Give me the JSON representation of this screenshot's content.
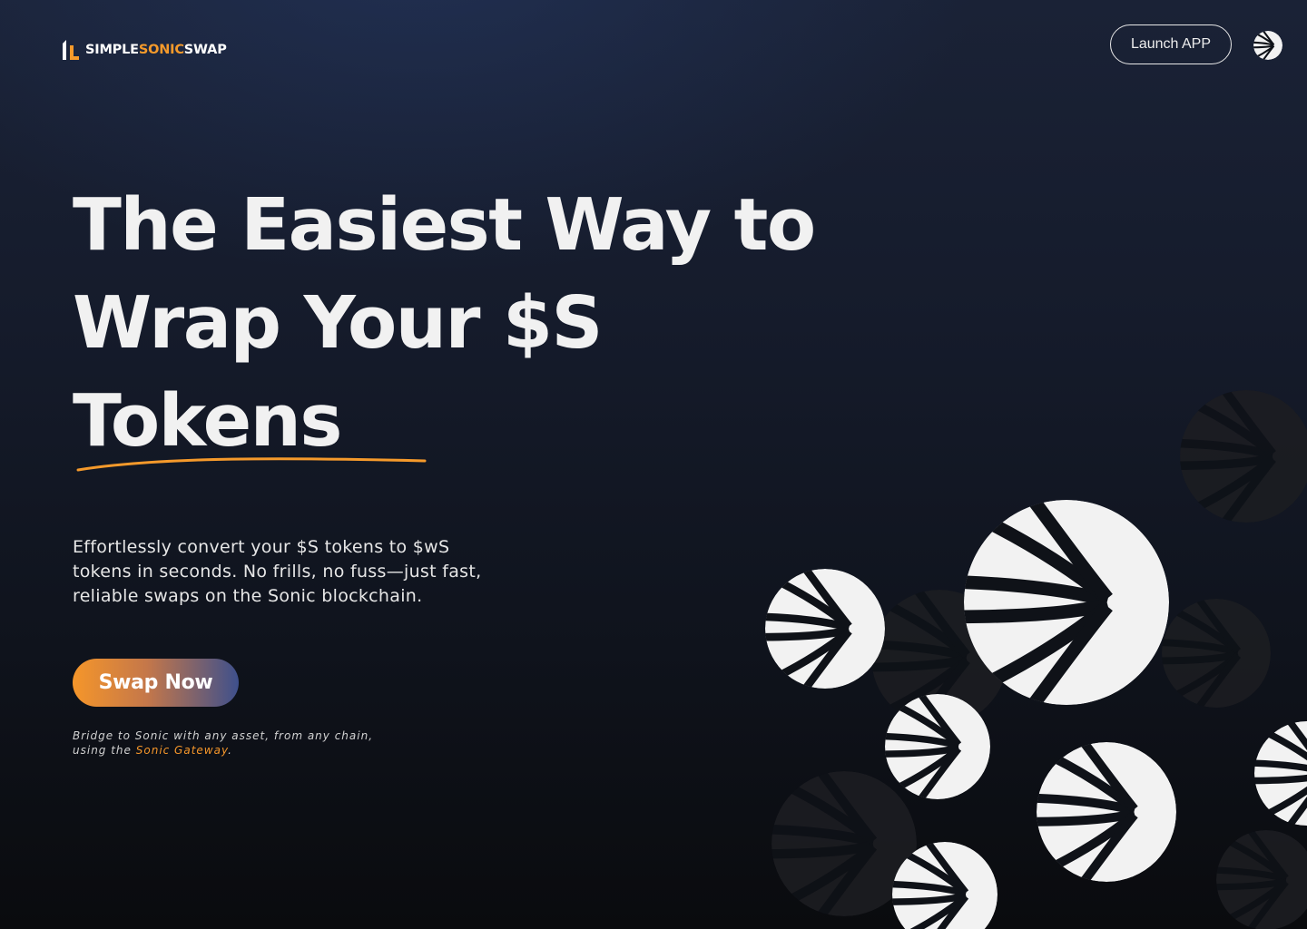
{
  "brand": {
    "name_parts": [
      "SIMPLE",
      "SONIC",
      "SWAP"
    ],
    "accent_color": "#f59a2b"
  },
  "header": {
    "launch_label": "Launch APP",
    "sonic_icon": "sonic-logo-icon"
  },
  "hero": {
    "headline_lines": [
      "The Easiest Way to",
      "Wrap Your $S",
      "Tokens"
    ],
    "subtext_lines": [
      "Effortlessly convert your $S tokens to $wS",
      "tokens in seconds. No frills, no fuss—just fast,",
      "reliable swaps on the Sonic blockchain."
    ],
    "cta_label": "Swap Now",
    "bridge_line1": "Bridge to Sonic with any asset, from any chain,",
    "bridge_line2_prefix": "using the ",
    "bridge_link": "Sonic Gateway",
    "bridge_line2_suffix": "."
  },
  "colors": {
    "cta_gradient": [
      "#f5962a",
      "#3e508c"
    ],
    "underline": "#f59a2b",
    "coin_light": "#f2f2f2",
    "coin_dark": "#1b1b1d"
  }
}
